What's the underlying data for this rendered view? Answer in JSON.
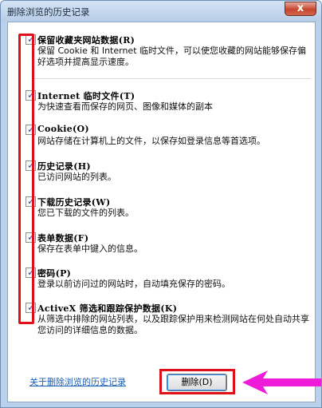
{
  "window": {
    "title": "删除浏览的历史记录",
    "close_label": "x"
  },
  "items": [
    {
      "title": "保留收藏夹网站数据(R)",
      "desc": "保留 Cookie 和 Internet 临时文件，可以使您收藏的网站能够保存偏好选项并提高显示速度。",
      "checked": true
    },
    {
      "title": "Internet 临时文件(T)",
      "desc": "为快速查看而保存的网页、图像和媒体的副本",
      "checked": true
    },
    {
      "title": "Cookie(O)",
      "desc": "网站存储在计算机上的文件，以保存如登录信息等首选项。",
      "checked": true
    },
    {
      "title": "历史记录(H)",
      "desc": "已访问网站的列表。",
      "checked": true
    },
    {
      "title": "下载历史记录(W)",
      "desc": "您已下载的文件的列表。",
      "checked": true
    },
    {
      "title": "表单数据(F)",
      "desc": "保存在表单中键入的信息。",
      "checked": true
    },
    {
      "title": "密码(P)",
      "desc": "登录以前访问过的网站时，自动填充保存的密码。",
      "checked": true
    },
    {
      "title": "ActiveX 筛选和跟踪保护数据(K)",
      "desc": "从筛选中排除的网站列表，以及跟踪保护用来检测网站在何处自动共享您访问的详细信息的数据。",
      "checked": true
    }
  ],
  "footer": {
    "help_link": "关于删除浏览的历史记录",
    "delete_label": "删除(D)"
  },
  "colors": {
    "highlight": "#e0101a",
    "arrow": "#ee1cd8",
    "link": "#1a5fb4"
  }
}
